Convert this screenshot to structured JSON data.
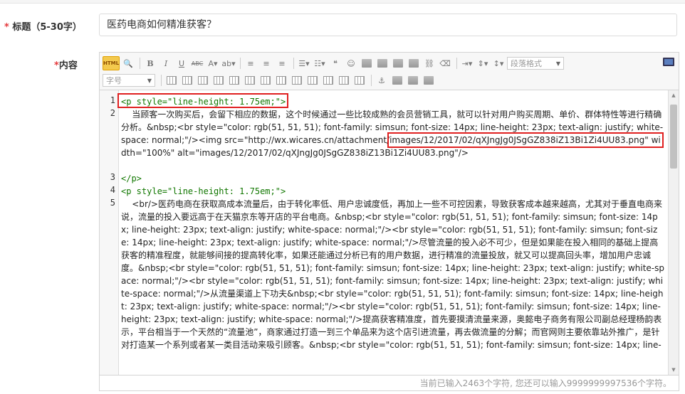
{
  "form": {
    "title_label": "标题（5-30字）",
    "title_required": "*",
    "title_value": "医药电商如何精准获客？",
    "content_label": "内容",
    "content_required": "*"
  },
  "toolbar": {
    "html_label": "HTML",
    "paragraph_format": "段落格式",
    "font_size": "字号"
  },
  "code": {
    "line_numbers": [
      "1",
      "2",
      "",
      "",
      "",
      "",
      "3",
      "4",
      "5"
    ],
    "lines": [
      "<p style=\"line-height: 1.75em;\">",
      "    当顾客一次购买后，会留下相应的数据，这个时候通过一些比较成熟的会员营销工具，就可以针对用户购买周期、单价、群体特性等进行精确分析。&nbsp;<br style=\"color: rgb(51, 51, 51); font-family: simsun; font-size: 14px; line-height: 23px; text-align: justify; white-space: normal;\"/><img src=\"http://wx.wicares.cn/attachment/images/12/2017/02/qXJngJg0JSgGZ838iZ13Bi1Zi4UU83.png\" width=\"100%\" alt=\"images/12/2017/02/qXJngJg0JSgGZ838iZ13Bi1Zi4UU83.png\"/>",
      "</p>",
      "<p style=\"line-height: 1.75em;\">",
      "    <br/>医药电商在获取高成本流量后，由于转化率低、用户忠诚度低，再加上一些不可控因素，导致获客成本越来越高，尤其对于垂直电商来说，流量的投入要远高于在天猫京东等开店的平台电商。&nbsp;<br style=\"color: rgb(51, 51, 51); font-family: simsun; font-size: 14px; line-height: 23px; text-align: justify; white-space: normal;\"/><br style=\"color: rgb(51, 51, 51); font-family: simsun; font-size: 14px; line-height: 23px; text-align: justify; white-space: normal;\"/>尽管流量的投入必不可少，但是如果能在投入相同的基础上提高获客的精准程度，就能够间接的提高转化率，如果还能通过分析已有的用户数据，进行精准的流量投放，就又可以提高回头率，增加用户忠诚度。&nbsp;<br style=\"color: rgb(51, 51, 51); font-family: simsun; font-size: 14px; line-height: 23px; text-align: justify; white-space: normal;\"/><br style=\"color: rgb(51, 51, 51); font-family: simsun; font-size: 14px; line-height: 23px; text-align: justify; white-space: normal;\"/>从流量渠道上下功夫&nbsp;<br style=\"color: rgb(51, 51, 51); font-family: simsun; font-size: 14px; line-height: 23px; text-align: justify; white-space: normal;\"/><br style=\"color: rgb(51, 51, 51); font-family: simsun; font-size: 14px; line-height: 23px; text-align: justify; white-space: normal;\"/>提高获客精准度，首先要摸清流量来源，奥懿电子商务有限公司副总经理杨韵表示，平台相当于一个天然的“流量池”，商家通过打造一到三个单品来为这个店引进流量，再去做流量的分解；而官网则主要依靠站外推广，是针对打造某一个系列或者某一类目活动来吸引顾客。&nbsp;<br style=\"color: rgb(51, 51, 51); font-family: simsun; font-size: 14px; line-"
    ]
  },
  "status": {
    "text": "当前已输入2463个字符, 您还可以输入9999999997536个字符。"
  },
  "colors": {
    "highlight": "#e02020",
    "required": "#e4393c",
    "tag": "#117700",
    "attr": "#1a1aa6"
  }
}
